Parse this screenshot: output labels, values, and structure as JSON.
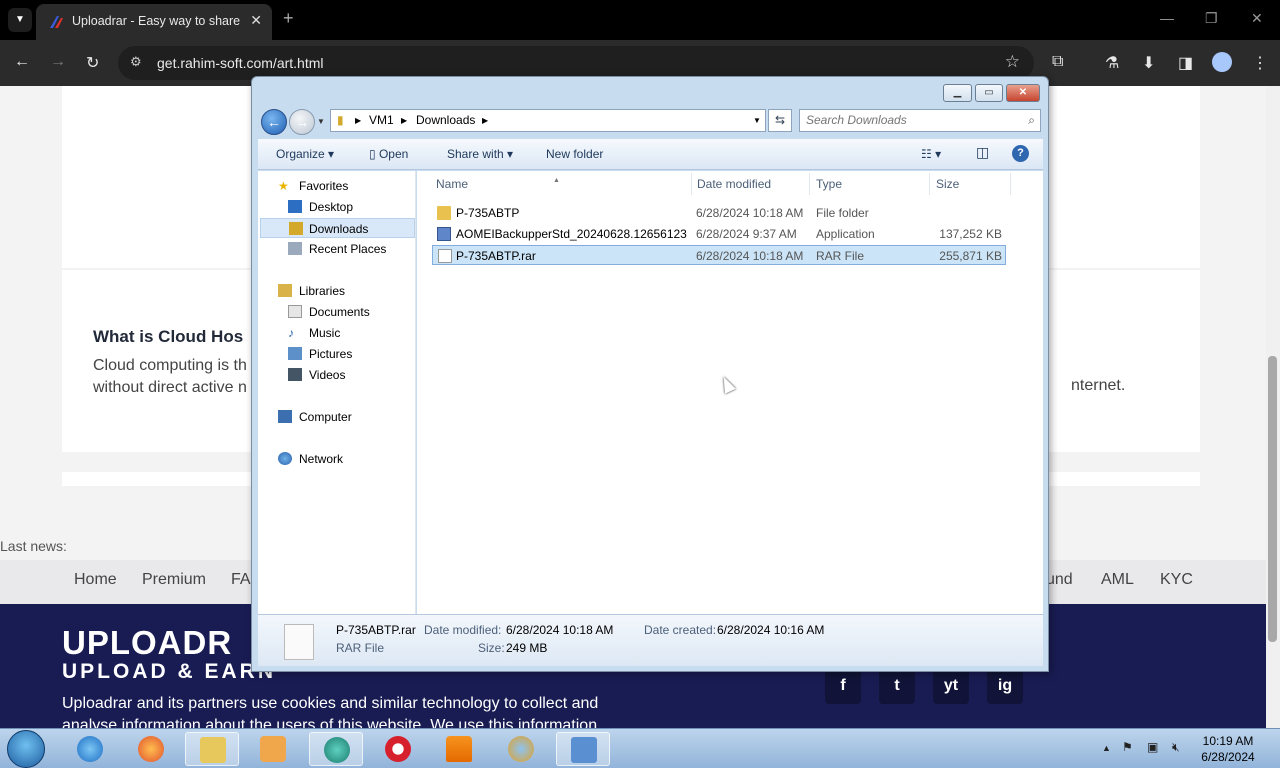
{
  "browser": {
    "tab_title": "Uploadrar - Easy way to share",
    "url": "get.rahim-soft.com/art.html"
  },
  "webpage": {
    "heading": "What is Cloud Hos",
    "paragraph_line1": "Cloud computing is th",
    "paragraph_line2": "without direct active n",
    "paragraph_tail": "nternet.",
    "last_news": "Last news:",
    "menu": [
      "Home",
      "Premium",
      "FA",
      "und",
      "AML",
      "KYC"
    ],
    "logo_top": "UPLOADR",
    "logo_bottom": "UPLOAD & EARN",
    "footer_text": "Uploadrar and its partners use cookies and similar technology to collect and analyse information about the users of this website. We use this information",
    "social": [
      "f",
      "t",
      "yt",
      "ig"
    ]
  },
  "explorer": {
    "breadcrumb": [
      "VM1",
      "Downloads"
    ],
    "search_placeholder": "Search Downloads",
    "toolbar": {
      "organize": "Organize",
      "open": "Open",
      "share_with": "Share with",
      "new_folder": "New folder"
    },
    "nav": {
      "favorites": "Favorites",
      "desktop": "Desktop",
      "downloads": "Downloads",
      "recent": "Recent Places",
      "libraries": "Libraries",
      "documents": "Documents",
      "music": "Music",
      "pictures": "Pictures",
      "videos": "Videos",
      "computer": "Computer",
      "network": "Network"
    },
    "columns": {
      "name": "Name",
      "date": "Date modified",
      "type": "Type",
      "size": "Size"
    },
    "files": [
      {
        "name": "P-735ABTP",
        "date": "6/28/2024 10:18 AM",
        "type": "File folder",
        "size": ""
      },
      {
        "name": "AOMEIBackupperStd_20240628.12656123",
        "date": "6/28/2024 9:37 AM",
        "type": "Application",
        "size": "137,252 KB"
      },
      {
        "name": "P-735ABTP.rar",
        "date": "6/28/2024 10:18 AM",
        "type": "RAR File",
        "size": "255,871 KB"
      }
    ],
    "details": {
      "filename": "P-735ABTP.rar",
      "filetype": "RAR File",
      "date_modified_label": "Date modified:",
      "date_modified": "6/28/2024 10:18 AM",
      "size_label": "Size:",
      "size": "249 MB",
      "date_created_label": "Date created:",
      "date_created": "6/28/2024 10:16 AM"
    }
  },
  "taskbar": {
    "time": "10:19 AM",
    "date": "6/28/2024"
  }
}
